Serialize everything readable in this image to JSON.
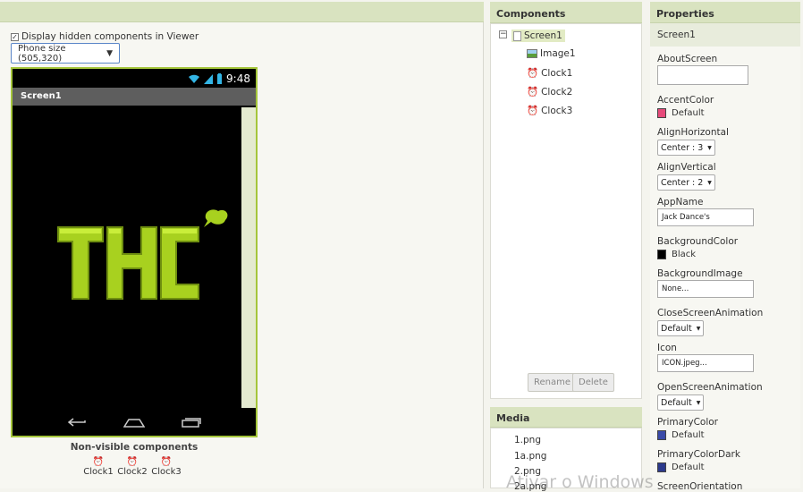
{
  "viewer": {
    "hidden_label": "Display hidden components in Viewer",
    "size_select": "Phone size (505,320)",
    "status_time": "9:48",
    "screen_title": "Screen1",
    "nonvisible_title": "Non-visible components",
    "nonvisible": [
      {
        "label": "Clock1"
      },
      {
        "label": "Clock2"
      },
      {
        "label": "Clock3"
      }
    ]
  },
  "components": {
    "title": "Components",
    "tree": [
      {
        "label": "Screen1",
        "icon": "screen-icon"
      },
      {
        "label": "Image1",
        "icon": "image-icon"
      },
      {
        "label": "Clock1",
        "icon": "clock-icon"
      },
      {
        "label": "Clock2",
        "icon": "clock-icon"
      },
      {
        "label": "Clock3",
        "icon": "clock-icon"
      }
    ],
    "rename_label": "Rename",
    "delete_label": "Delete"
  },
  "media": {
    "title": "Media",
    "items": [
      "1.png",
      "1a.png",
      "2.png",
      "2a.png"
    ]
  },
  "properties": {
    "title": "Properties",
    "screen": "Screen1",
    "about": {
      "label": "AboutScreen",
      "value": ""
    },
    "accent": {
      "label": "AccentColor",
      "value": "Default",
      "color": "#e64a7a"
    },
    "align_h": {
      "label": "AlignHorizontal",
      "value": "Center : 3"
    },
    "align_v": {
      "label": "AlignVertical",
      "value": "Center : 2"
    },
    "app_name": {
      "label": "AppName",
      "value": "Jack Dance's"
    },
    "bg_color": {
      "label": "BackgroundColor",
      "value": "Black",
      "color": "#000000"
    },
    "bg_image": {
      "label": "BackgroundImage",
      "value": "None..."
    },
    "close_anim": {
      "label": "CloseScreenAnimation",
      "value": "Default"
    },
    "icon": {
      "label": "Icon",
      "value": "ICON.jpeg..."
    },
    "open_anim": {
      "label": "OpenScreenAnimation",
      "value": "Default"
    },
    "primary": {
      "label": "PrimaryColor",
      "value": "Default",
      "color": "#3a4aa8"
    },
    "primary_dark": {
      "label": "PrimaryColorDark",
      "value": "Default",
      "color": "#2c3a8c"
    },
    "orientation": {
      "label": "ScreenOrientation"
    }
  },
  "watermark": "Ativar o Windows",
  "colors": {
    "accent_green": "#a5c63b",
    "header_bar": "#d9e3c0"
  }
}
